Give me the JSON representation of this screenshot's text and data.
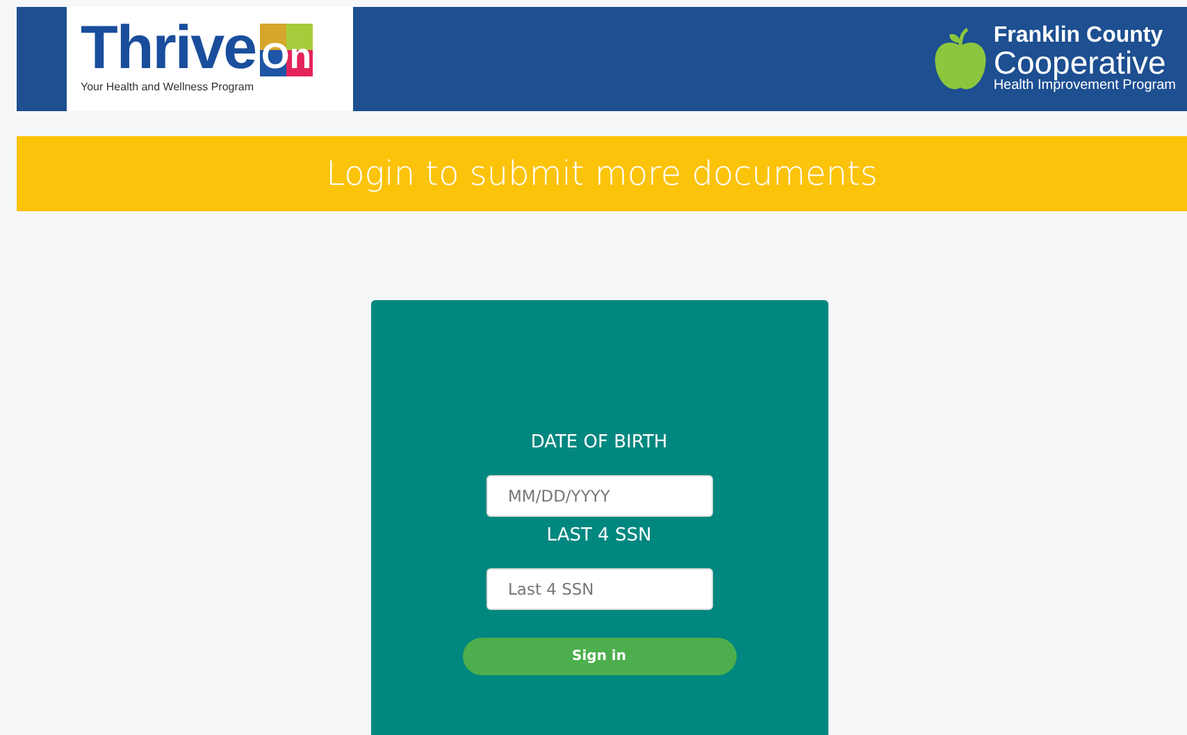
{
  "header": {
    "logo": {
      "word": "Thrive",
      "badge": "On",
      "tagline": "Your Health and Wellness Program"
    },
    "partner": {
      "line_1": "Franklin County",
      "line_2": "Cooperative",
      "line_3": "Health Improvement Program"
    }
  },
  "banner": {
    "title": "Login to submit more documents"
  },
  "login": {
    "fields": [
      {
        "label": "DATE OF BIRTH",
        "placeholder": "MM/DD/YYYY"
      },
      {
        "label": "LAST 4 SSN",
        "placeholder": "Last 4 SSN"
      }
    ],
    "button": "Sign in"
  }
}
